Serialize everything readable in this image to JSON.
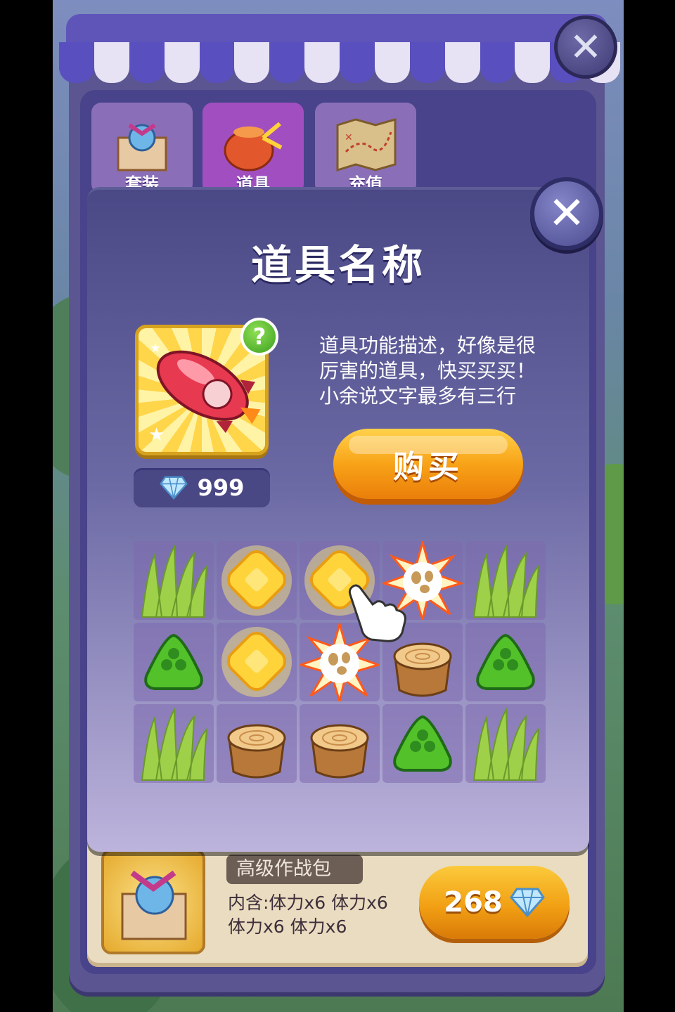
{
  "shop": {
    "tabs": [
      {
        "label": "套装",
        "icon": "gift-box-icon"
      },
      {
        "label": "道具",
        "icon": "pouch-icon"
      },
      {
        "label": "充值",
        "icon": "treasure-map-icon"
      }
    ],
    "package": {
      "name": "高级作战包",
      "desc_line1": "内含:体力x6  体力x6",
      "desc_line2": "体力x6  体力x6",
      "price": "268",
      "currency_icon": "diamond-icon"
    }
  },
  "popup": {
    "title": "道具名称",
    "item_icon": "rocket-icon",
    "help_label": "?",
    "price": "999",
    "currency_icon": "diamond-icon",
    "description": [
      "道具功能描述，好像是很",
      "厉害的道具，快买买买！",
      "小余说文字最多有三行"
    ],
    "buy_label": "购买",
    "close_label": "×"
  },
  "board": {
    "rows": [
      [
        "grass",
        "yellow-gem",
        "yellow-gem",
        "explosion",
        "grass"
      ],
      [
        "green-gem",
        "yellow-gem",
        "explosion",
        "tree-stump",
        "green-gem"
      ],
      [
        "grass",
        "tree-stump",
        "tree-stump",
        "green-gem",
        "grass"
      ]
    ]
  },
  "colors": {
    "accent_orange": "#f8a318",
    "popup_purple": "#4a4986",
    "gem_green": "#53c12a",
    "gem_yellow": "#ffd43a"
  }
}
